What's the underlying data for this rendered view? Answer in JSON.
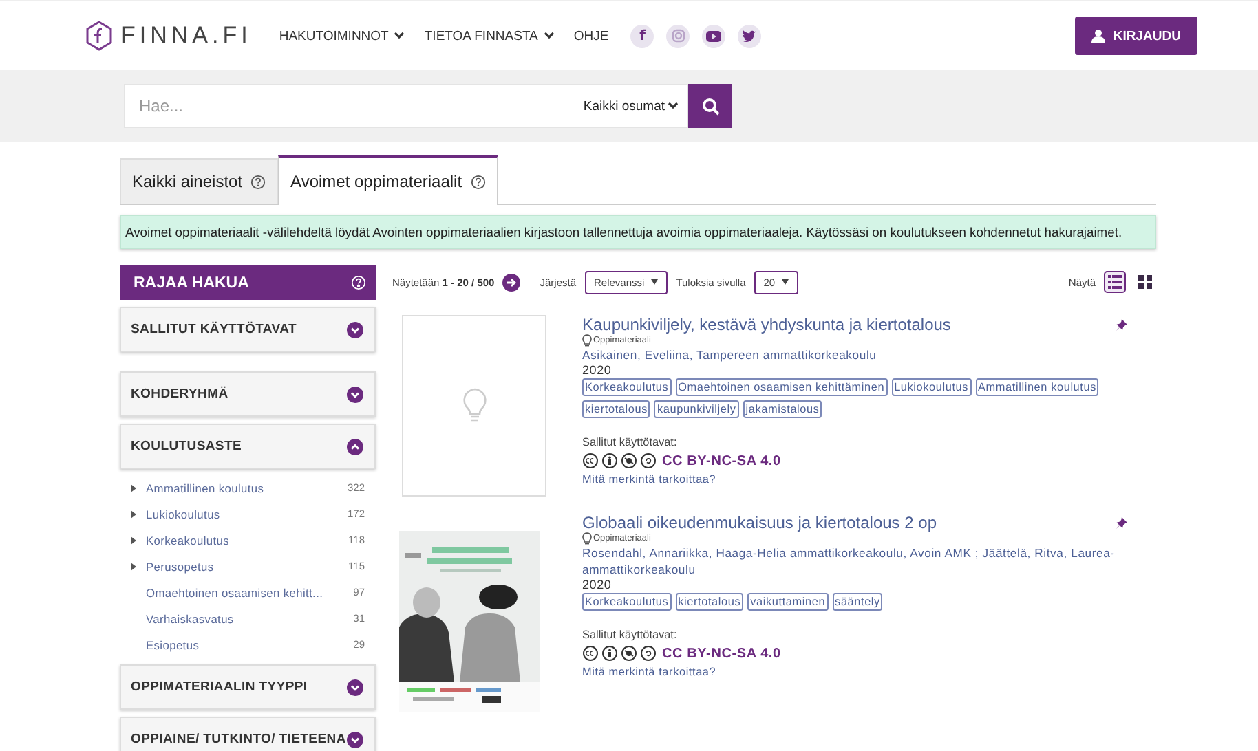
{
  "header": {
    "logo": "FINNA.FI",
    "nav": [
      {
        "label": "HAKUTOIMINNOT",
        "dropdown": true
      },
      {
        "label": "TIETOA FINNASTA",
        "dropdown": true
      },
      {
        "label": "OHJE",
        "dropdown": false
      }
    ],
    "social": [
      {
        "kind": "facebook",
        "label": "f"
      },
      {
        "kind": "instagram"
      },
      {
        "kind": "youtube"
      },
      {
        "kind": "twitter"
      }
    ],
    "login": "KIRJAUDU"
  },
  "search": {
    "placeholder": "Hae...",
    "scope": "Kaikki osumat"
  },
  "tabs": [
    {
      "label": "Kaikki aineistot",
      "selected": false
    },
    {
      "label": "Avoimet oppimateriaalit",
      "selected": true
    }
  ],
  "info": "Avoimet oppimateriaalit -välilehdeltä löydät Avointen oppimateriaalien kirjastoon tallennettuja avoimia oppimateriaaleja. Käytössäsi on koulutukseen kohdennetut hakurajaimet.",
  "sidebar": {
    "title": "RAJAA HAKUA",
    "facets": [
      {
        "label": "SALLITUT KÄYTTÖTAVAT",
        "expanded": false
      },
      {
        "label": "KOHDERYHMÄ",
        "expanded": false
      },
      {
        "label": "KOULUTUSASTE",
        "expanded": true,
        "items": [
          {
            "label": "Ammatillinen koulutus",
            "count": "322",
            "expandable": true
          },
          {
            "label": "Lukiokoulutus",
            "count": "172",
            "expandable": true
          },
          {
            "label": "Korkeakoulutus",
            "count": "118",
            "expandable": true
          },
          {
            "label": "Perusopetus",
            "count": "115",
            "expandable": true
          },
          {
            "label": "Omaehtoinen osaamisen kehitt...",
            "count": "97",
            "expandable": false
          },
          {
            "label": "Varhaiskasvatus",
            "count": "31",
            "expandable": false
          },
          {
            "label": "Esiopetus",
            "count": "29",
            "expandable": false
          }
        ]
      },
      {
        "label": "OPPIMATERIAALIN TYYPPI",
        "expanded": false
      },
      {
        "label": "OPPIAINE/ TUTKINTO/ TIETEENA",
        "expanded": false
      }
    ]
  },
  "toolbar": {
    "showing": "Näytetään **1 - 20 / 500**",
    "sort_label": "Järjestä",
    "sort": "Relevanssi",
    "per_page_label": "Tuloksia sivulla",
    "per_page": "20",
    "view_label": "Näytä",
    "views": [
      {
        "kind": "list",
        "selected": true
      },
      {
        "kind": "grid",
        "selected": false
      }
    ]
  },
  "results": [
    {
      "title": "Kaupunkiviljely, kestävä yhdyskunta ja kiertotalous",
      "kind": "placeholder",
      "format": "Oppimateriaali",
      "authors": "Asikainen, Eveliina, Tampereen ammattikorkeakoulu",
      "year": "2020",
      "tags": [
        "Korkeakoulutus",
        "Omaehtoinen osaamisen kehittäminen",
        "Lukiokoulutus",
        "Ammatillinen koulutus",
        "kiertotalous",
        "kaupunkiviljely",
        "jakamistalous"
      ],
      "rights_label": "Sallitut käyttötavat:",
      "license": "CC BY-NC-SA 4.0",
      "license_help": "Mitä merkintä tarkoittaa?"
    },
    {
      "title": "Globaali oikeudenmukaisuus ja kiertotalous 2 op",
      "kind": "picture",
      "format": "Oppimateriaali",
      "authors": "Rosendahl, Annariikka, Haaga-Helia ammattikorkeakoulu, Avoin AMK ; Jäättelä, Ritva, Laurea-ammattikorkeakoulu",
      "year": "2020",
      "tags": [
        "Korkeakoulutus",
        "kiertotalous",
        "vaikuttaminen",
        "sääntely"
      ],
      "rights_label": "Sallitut käyttötavat:",
      "license": "CC BY-NC-SA 4.0",
      "license_help": "Mitä merkintä tarkoittaa?"
    }
  ]
}
